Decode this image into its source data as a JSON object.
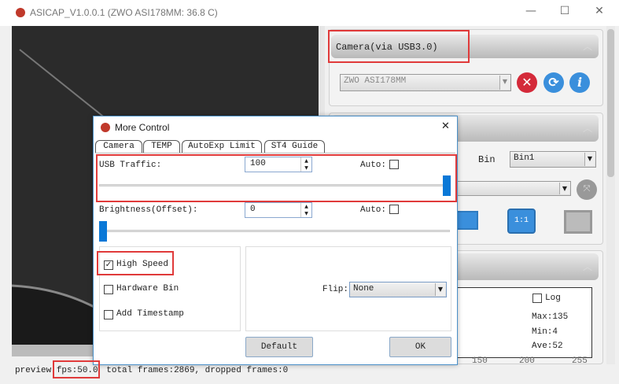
{
  "window": {
    "title": "ASICAP_V1.0.0.1 (ZWO ASI178MM: 36.8 C)",
    "minimize": "—",
    "maximize": "☐",
    "close": "✕"
  },
  "camera_panel": {
    "header": "Camera(via USB3.0)",
    "camera_select": "ZWO ASI178MM"
  },
  "format_panel": {
    "bin_label": "Bin",
    "bin_value": "Bin1"
  },
  "histogram": {
    "log_label": "Log",
    "log_checked": false,
    "max": "Max:135",
    "min": "Min:4",
    "ave": "Ave:52",
    "ticks": [
      "150",
      "200",
      "255"
    ]
  },
  "dialog": {
    "title": "More Control",
    "close": "✕",
    "tabs": [
      "Camera",
      "TEMP",
      "AutoExp Limit",
      "ST4 Guide"
    ],
    "usb_traffic": {
      "label": "USB Traffic:",
      "value": "100",
      "auto_label": "Auto:",
      "auto": false,
      "slider_fraction": 1.0
    },
    "brightness": {
      "label": "Brightness(Offset):",
      "value": "0",
      "auto_label": "Auto:",
      "auto": false,
      "slider_fraction": 0.0
    },
    "high_speed": {
      "label": "High Speed",
      "checked": true
    },
    "hardware_bin": {
      "label": "Hardware Bin",
      "checked": false
    },
    "add_timestamp": {
      "label": "Add Timestamp",
      "checked": false
    },
    "flip": {
      "label": "Flip:",
      "value": "None"
    },
    "default_button": "Default",
    "ok_button": "OK"
  },
  "status": {
    "preview": "preview",
    "fps": "fps:50.0",
    "rest": "total frames:2869, dropped frames:0"
  },
  "colors": {
    "accent": "#0a78d7",
    "highlight": "#e03a3a"
  }
}
